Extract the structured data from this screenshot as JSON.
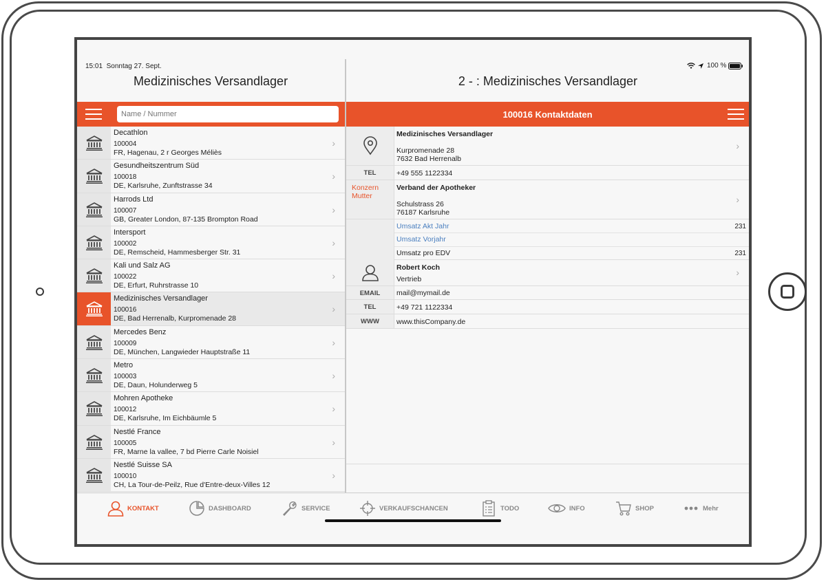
{
  "status": {
    "time": "15:01",
    "date": "Sonntag 27. Sept.",
    "battery": "100 %"
  },
  "left": {
    "title": "Medizinisches Versandlager",
    "search_placeholder": "Name / Nummer",
    "items": [
      {
        "name": "Decathlon",
        "number": "100004",
        "address": "FR, Hagenau, 2 r Georges Méliès"
      },
      {
        "name": "Gesundheitszentrum Süd",
        "number": "100018",
        "address": "DE, Karlsruhe, Zunftstrasse 34"
      },
      {
        "name": "Harrods Ltd",
        "number": "100007",
        "address": "GB, Greater London, 87-135 Brompton Road"
      },
      {
        "name": "Intersport",
        "number": "100002",
        "address": "DE, Remscheid, Hammesberger Str. 31"
      },
      {
        "name": "Kali und Salz AG",
        "number": "100022",
        "address": "DE, Erfurt, Ruhrstrasse 10"
      },
      {
        "name": "Medizinisches Versandlager",
        "number": "100016",
        "address": "DE, Bad Herrenalb, Kurpromenade 28"
      },
      {
        "name": "Mercedes Benz",
        "number": "100009",
        "address": "DE, München, Langwieder Hauptstraße 11"
      },
      {
        "name": "Metro",
        "number": "100003",
        "address": "DE, Daun, Holunderweg 5"
      },
      {
        "name": "Mohren Apotheke",
        "number": "100012",
        "address": "DE, Karlsruhe, Im Eichbäumle 5"
      },
      {
        "name": "Nestlé France",
        "number": "100005",
        "address": "FR, Marne la vallee, 7 bd Pierre Carle Noisiel"
      },
      {
        "name": "Nestlé Suisse SA",
        "number": "100010",
        "address": "CH, La Tour-de-Peilz, Rue d'Entre-deux-Villes 12"
      }
    ]
  },
  "right": {
    "title": "2 -  : Medizinisches Versandlager",
    "bar_title": "100016 Kontaktdaten",
    "company": {
      "name": "Medizinisches Versandlager",
      "street": "Kurpromenade 28",
      "city": "7632 Bad Herrenalb"
    },
    "tel_label": "TEL",
    "tel": "+49 555 1122334",
    "konzern_label": "Konzern Mutter",
    "parent": {
      "name": "Verband der Apotheker",
      "street": "Schulstrass 26",
      "city": "76187 Karlsruhe"
    },
    "umsatz_akt_label": "Umsatz Akt Jahr",
    "umsatz_akt_value": "231",
    "umsatz_vorjahr_label": "Umsatz Vorjahr",
    "umsatz_edv_label": "Umsatz pro EDV",
    "umsatz_edv_value": "231",
    "person": {
      "name": "Robert Koch",
      "role": "Vertrieb"
    },
    "email_label": "EMAIL",
    "email": "mail@mymail.de",
    "tel2_label": "TEL",
    "tel2": "+49 721 1122334",
    "www_label": "WWW",
    "www": "www.thisCompany.de"
  },
  "tabs": {
    "kontakt": "KONTAKT",
    "dashboard": "DASHBOARD",
    "service": "SERVICE",
    "verkaufschancen": "VERKAUFSCHANCEN",
    "todo": "TODO",
    "info": "INFO",
    "shop": "SHOP",
    "mehr": "Mehr"
  },
  "colors": {
    "accent": "#e8532a",
    "link": "#4a7fbf"
  }
}
